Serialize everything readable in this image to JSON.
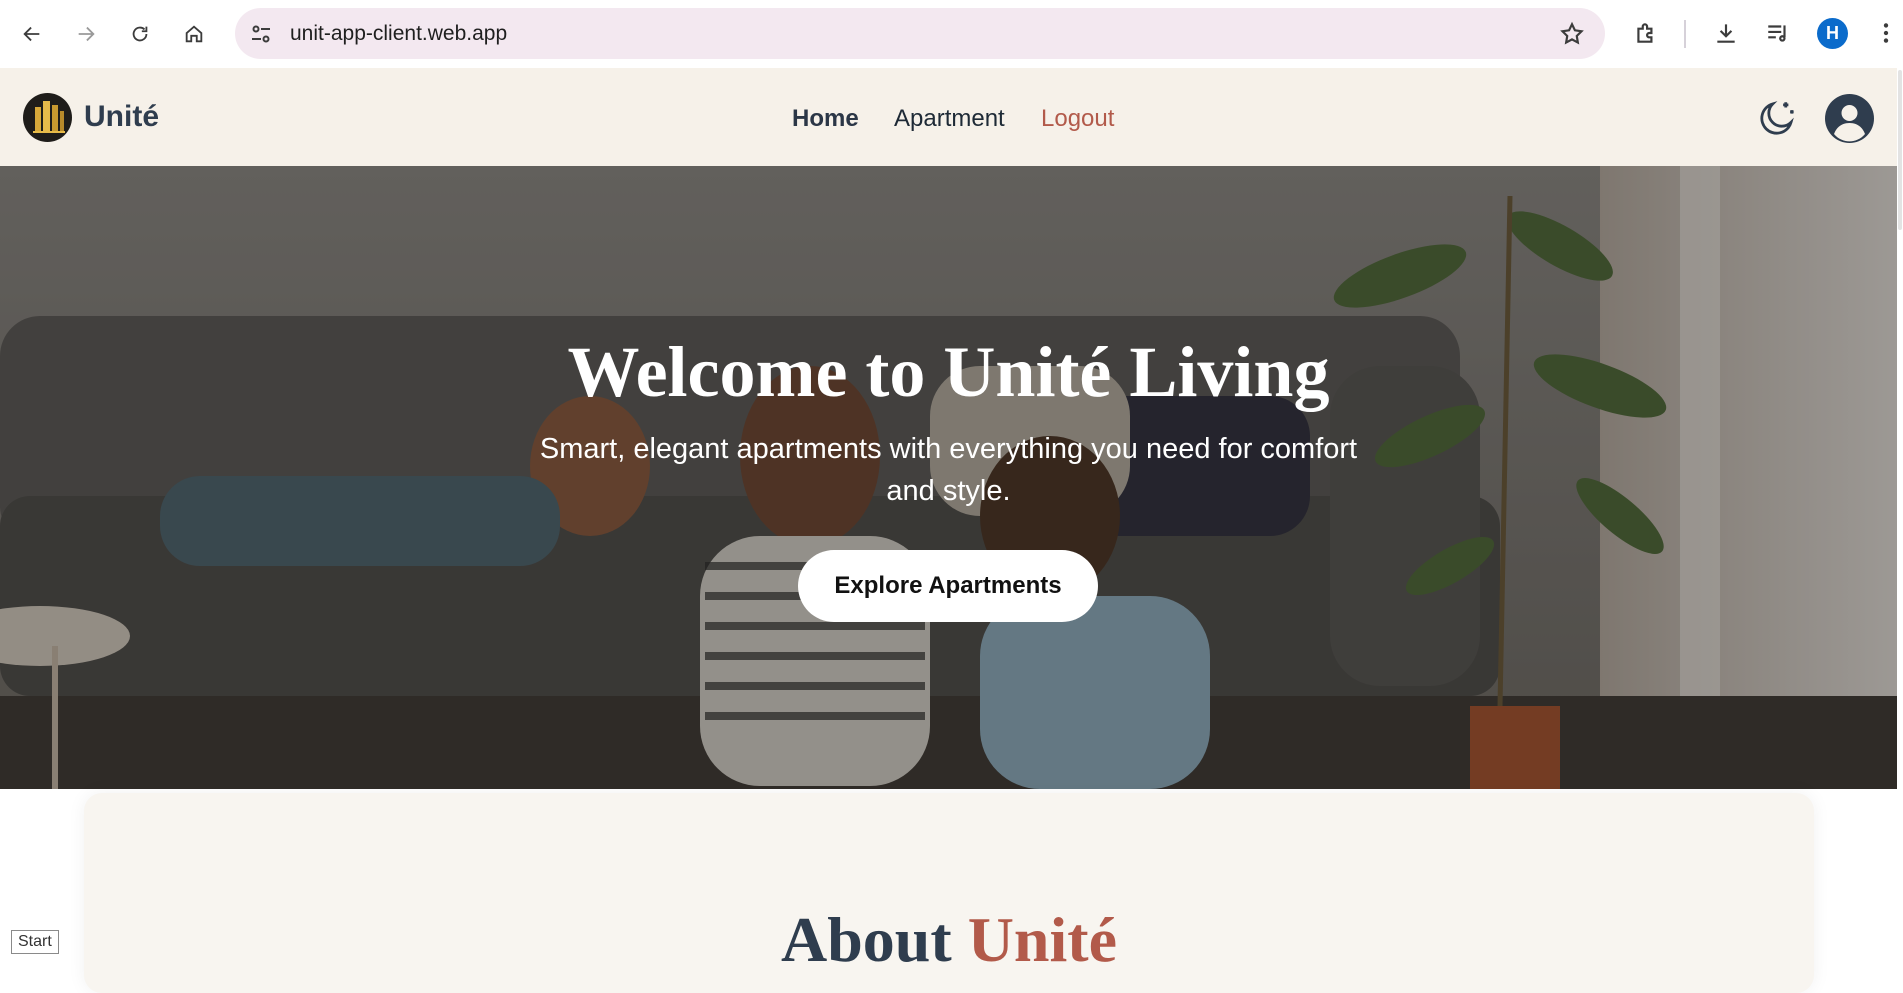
{
  "browser": {
    "url": "unit-app-client.web.app",
    "profile_initial": "H"
  },
  "header": {
    "brand": "Unité",
    "nav": {
      "home": "Home",
      "apartment": "Apartment",
      "logout": "Logout"
    }
  },
  "hero": {
    "title": "Welcome to Unité Living",
    "subtitle": "Smart, elegant apartments with everything you need for comfort and style.",
    "cta": "Explore Apartments"
  },
  "about": {
    "title_prefix": "About ",
    "title_accent": "Unité"
  },
  "status": {
    "start_label": "Start"
  },
  "colors": {
    "header_bg": "#f6f1e9",
    "brand_text": "#2f3d4e",
    "accent": "#b25a4a",
    "omnibox_bg": "#f3e8f0",
    "profile_bg": "#0b6bcb"
  }
}
